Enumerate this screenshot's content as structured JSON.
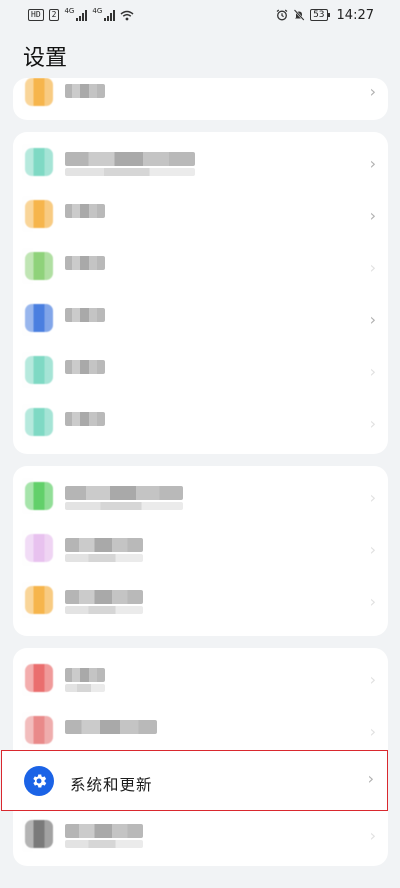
{
  "status_bar": {
    "hd_badge": "HD",
    "sim_badge": "2",
    "net_label_1": "4G",
    "net_label_2": "4G",
    "battery": "53",
    "time": "14:27",
    "icons": [
      "hd-badge",
      "signal-icon",
      "signal-icon",
      "wifi-icon",
      "alarm-icon",
      "mute-icon",
      "battery-icon"
    ]
  },
  "page": {
    "title": "设置"
  },
  "highlighted_item": {
    "label": "系统和更新",
    "icon": "gear-icon",
    "icon_color": "#1b63e6"
  },
  "colors": {
    "background": "#f1f3f5",
    "card": "#ffffff",
    "highlight_border": "#d9282e",
    "chevron": "#b0b0b0"
  },
  "menu_groups": [
    {
      "items": [
        {
          "icon_color": "#f6b54c"
        }
      ]
    },
    {
      "items": [
        {
          "icon_color": "#7fd9c4"
        },
        {
          "icon_color": "#f6b54c"
        },
        {
          "icon_color": "#8fd27a"
        },
        {
          "icon_color": "#4a7fe0"
        },
        {
          "icon_color": "#7fd9c4"
        },
        {
          "icon_color": "#7fd9c4"
        }
      ]
    },
    {
      "items": [
        {
          "icon_color": "#62d06a"
        },
        {
          "icon_color": "#e8c2ef"
        },
        {
          "icon_color": "#f6b54c"
        }
      ]
    },
    {
      "items": [
        {
          "icon_color": "#ea6e6e"
        },
        {
          "icon_color": "#e98a8a"
        },
        {
          "icon_color": "#1b63e6"
        },
        {
          "icon_color": "#7a7a7a"
        }
      ]
    }
  ]
}
